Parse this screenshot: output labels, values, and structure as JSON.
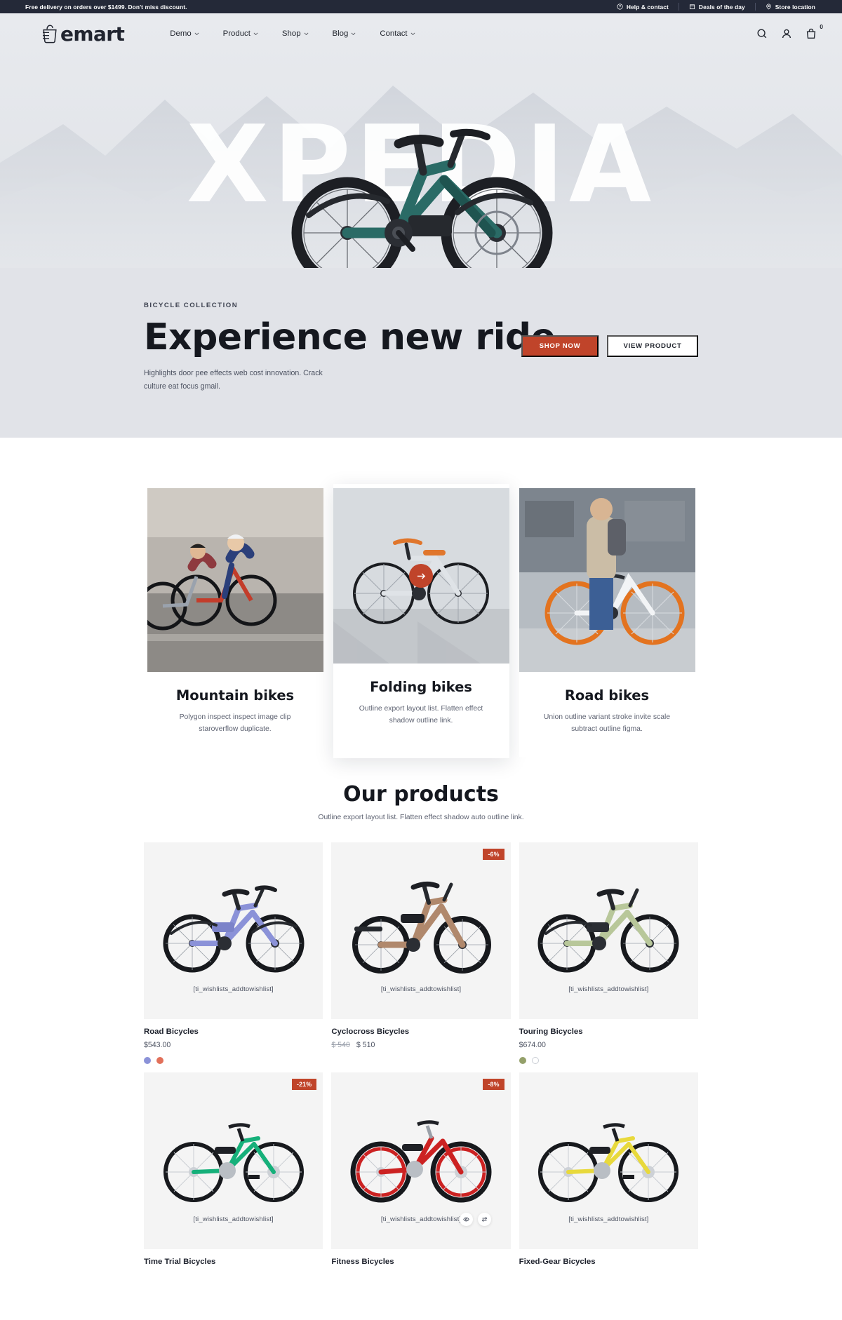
{
  "topbar": {
    "promo": "Free delivery on orders over $1499. Don't miss discount.",
    "links": [
      {
        "label": "Help & contact",
        "icon": "question-circle-icon"
      },
      {
        "label": "Deals of the day",
        "icon": "calendar-icon"
      },
      {
        "label": "Store location",
        "icon": "location-pin-icon"
      }
    ]
  },
  "header": {
    "brand": "emart",
    "nav": [
      {
        "label": "Demo",
        "has_caret": true
      },
      {
        "label": "Product",
        "has_caret": true
      },
      {
        "label": "Shop",
        "has_caret": true
      },
      {
        "label": "Blog",
        "has_caret": true
      },
      {
        "label": "Contact",
        "has_caret": true
      }
    ],
    "actions": {
      "search": "search-icon",
      "account": "user-icon",
      "cart": "cart-icon",
      "cart_count": "0"
    }
  },
  "hero": {
    "watermark": "XPEDIA",
    "eyebrow": "BICYCLE COLLECTION",
    "title": "Experience new ride",
    "description": "Highlights door pee effects web cost innovation. Crack culture eat focus gmail.",
    "primary_button": "SHOP NOW",
    "secondary_button": "VIEW PRODUCT",
    "accent_color": "#c0442a"
  },
  "categories": [
    {
      "title": "Mountain bikes",
      "description": "Polygon inspect inspect image clip staroverflow duplicate.",
      "featured": false
    },
    {
      "title": "Folding bikes",
      "description": "Outline export layout list. Flatten effect shadow outline link.",
      "featured": true
    },
    {
      "title": "Road bikes",
      "description": "Union outline variant stroke invite scale subtract outline figma.",
      "featured": false
    }
  ],
  "products_section": {
    "title": "Our products",
    "subtitle": "Outline export layout list. Flatten effect shadow auto outline link.",
    "wishlist_label": "[ti_wishlists_addtowishlist]"
  },
  "products": [
    {
      "name": "Road Bicycles",
      "price": "$543.00",
      "old_price": "",
      "badge": "",
      "frame_color": "#8b92d8",
      "swatches": [
        "#8b92d8",
        "#e2705a"
      ],
      "has_quick_actions": false
    },
    {
      "name": "Cyclocross Bicycles",
      "price": "$ 510",
      "old_price": "$ 540",
      "badge": "-6%",
      "frame_color": "#b0886c",
      "swatches": [],
      "has_quick_actions": false
    },
    {
      "name": "Touring Bicycles",
      "price": "$674.00",
      "old_price": "",
      "badge": "",
      "frame_color": "#b8c79a",
      "swatches": [
        "#94a06a",
        "ring"
      ],
      "has_quick_actions": false
    },
    {
      "name": "Time Trial Bicycles",
      "price": "",
      "old_price": "",
      "badge": "-21%",
      "frame_color": "#16b07a",
      "swatches": [],
      "has_quick_actions": false
    },
    {
      "name": "Fitness Bicycles",
      "price": "",
      "old_price": "",
      "badge": "-8%",
      "frame_color": "#cc2222",
      "swatches": [],
      "has_quick_actions": true
    },
    {
      "name": "Fixed-Gear Bicycles",
      "price": "",
      "old_price": "",
      "badge": "",
      "frame_color": "#e8d93c",
      "swatches": [],
      "has_quick_actions": false
    }
  ]
}
